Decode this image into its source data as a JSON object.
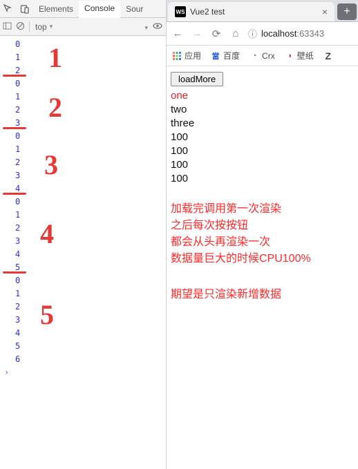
{
  "devtools": {
    "tabs": {
      "elements": "Elements",
      "console": "Console",
      "sources_partial": "Sour"
    },
    "toolbar": {
      "context": "top"
    },
    "console_rows": [
      "0",
      "1",
      "2",
      "0",
      "1",
      "2",
      "3",
      "0",
      "1",
      "2",
      "3",
      "4",
      "0",
      "1",
      "2",
      "3",
      "4",
      "5",
      "0",
      "1",
      "2",
      "3",
      "4",
      "5",
      "6"
    ],
    "separators_after_index": [
      2,
      6,
      11,
      17
    ],
    "annotations": [
      "1",
      "2",
      "3",
      "4",
      "5"
    ]
  },
  "browser": {
    "tab": {
      "favicon_text": "WS",
      "title": "Vue2 test"
    },
    "url": {
      "info_icon": "ⓘ",
      "host": "localhost",
      "port_partial": ":63343"
    },
    "bookmarks": {
      "apps": "应用",
      "baidu": "百度",
      "crx": "Crx",
      "wallpaper": "壁纸"
    },
    "page": {
      "button": "loadMore",
      "items": [
        "one",
        "two",
        "three",
        "100",
        "100",
        "100",
        "100"
      ],
      "note_lines": [
        "加载完调用第一次渲染",
        "之后每次按按钮",
        "都会从头再渲染一次",
        "数据量巨大的时候CPU100%"
      ],
      "note2": "期望是只渲染新增数据"
    }
  }
}
